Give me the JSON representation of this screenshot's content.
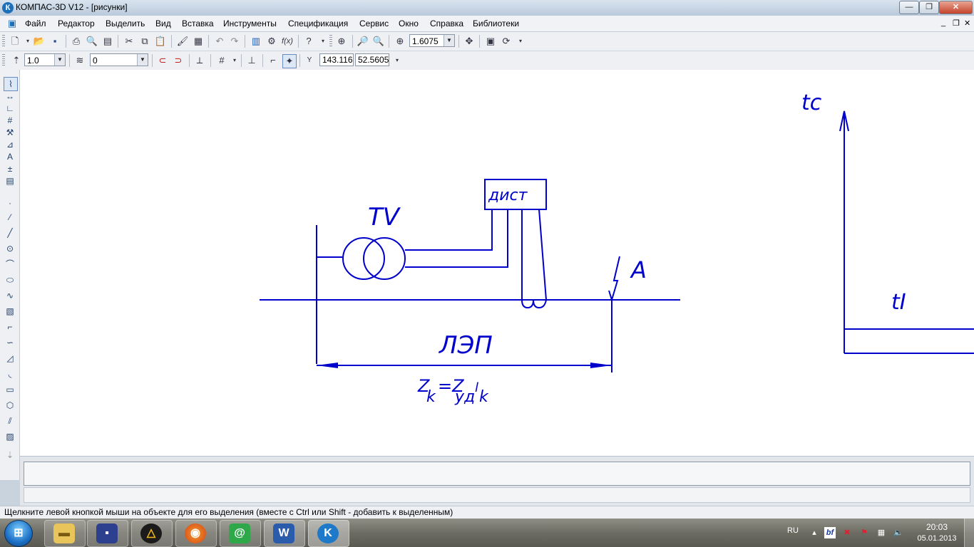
{
  "window": {
    "title": "КОМПАС-3D V12 - [рисунки]",
    "app_icon_letter": "К",
    "minimize_label": "—",
    "maximize_label": "❐",
    "close_label": "✕"
  },
  "menu": {
    "items": [
      "Файл",
      "Редактор",
      "Выделить",
      "Вид",
      "Вставка",
      "Инструменты",
      "Спецификация",
      "Сервис",
      "Окно",
      "Справка",
      "Библиотеки"
    ],
    "mdi_minimize": "_",
    "mdi_restore": "❐",
    "mdi_close": "✕"
  },
  "toolbar_standard": {
    "zoom_value": "1.6075",
    "icons": [
      "new-document-icon",
      "open-icon",
      "save-icon",
      "print-icon",
      "print-preview-icon",
      "print-setup-icon",
      "cut-icon",
      "copy-icon",
      "paste-icon",
      "format-painter-icon",
      "properties-icon",
      "undo-icon",
      "redo-icon",
      "manager-icon",
      "libraries-icon",
      "formula-icon",
      "help-pointer-icon",
      "zoom-window-icon",
      "zoom-in-icon",
      "zoom-out-icon",
      "zoom-scale-icon",
      "pan-icon",
      "refresh-icon",
      "redraw-icon"
    ]
  },
  "toolbar_current_state": {
    "style_value": "1.0",
    "layer_value": "0",
    "x_value": "143.116",
    "y_value": "52.5605",
    "coord_label": "Y"
  },
  "drawing": {
    "label_tv": "TV",
    "label_relay": "дист",
    "label_fault": "A",
    "label_line": "ЛЭП",
    "formula": {
      "z": "Z",
      "k1": "k",
      "eq": "=Z",
      "ud": "уд",
      "l": "l",
      "k2": "k"
    },
    "graph_y_label": "tc",
    "graph_step_label": "tI",
    "line_color": "#0000cc"
  },
  "status": {
    "message": "Щелкните левой кнопкой мыши на объекте для его выделения (вместе с Ctrl или Shift - добавить к выделенным)"
  },
  "taskbar": {
    "apps": [
      "file-explorer",
      "save-disk",
      "warning-app",
      "firefox",
      "mail-agent",
      "word",
      "kompas"
    ],
    "word_letter": "W",
    "kompas_letter": "K",
    "mail_symbol": "@",
    "lang": "RU",
    "time": "20:03",
    "date": "05.01.2013"
  }
}
